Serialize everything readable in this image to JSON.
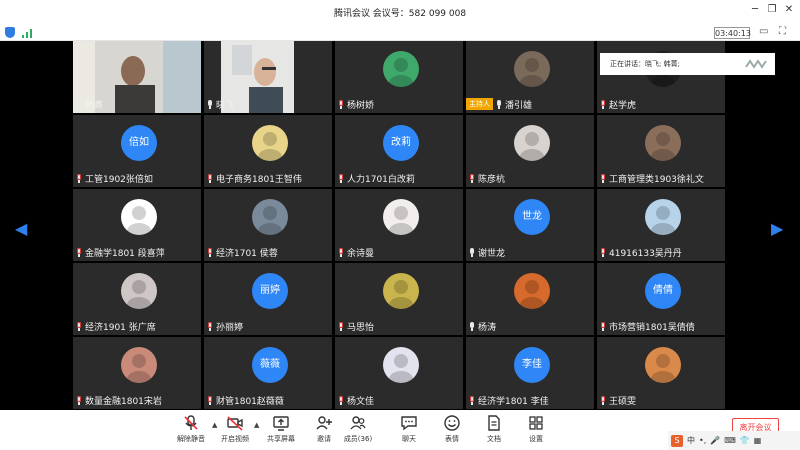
{
  "window": {
    "title": "腾讯会议  会议号：582 099 008"
  },
  "infobar": {
    "timer": "03:40:13"
  },
  "speaking": {
    "text": "正在讲话：晓飞; 韩菁;"
  },
  "host_badge": "主持人",
  "participants": [
    {
      "name": "韩菁",
      "type": "video",
      "mic": "on"
    },
    {
      "name": "晓飞",
      "type": "video",
      "mic": "on"
    },
    {
      "name": "杨树娇",
      "type": "photo",
      "mic": "muted",
      "color": "#3fa86b"
    },
    {
      "name": "潘引雄",
      "type": "photo",
      "mic": "on",
      "host": true,
      "color": "#7a6a5a"
    },
    {
      "name": "赵学虎",
      "type": "photo",
      "mic": "muted",
      "color": "#1f1f1f"
    },
    {
      "name": "工管1902张倍如",
      "type": "text",
      "avatar": "倍如",
      "mic": "muted"
    },
    {
      "name": "电子商务1801王智伟",
      "type": "photo",
      "mic": "muted",
      "color": "#e8d58a"
    },
    {
      "name": "人力1701白改莉",
      "type": "text",
      "avatar": "改莉",
      "mic": "muted"
    },
    {
      "name": "陈彦杭",
      "type": "photo",
      "mic": "muted",
      "color": "#d9d3cf"
    },
    {
      "name": "工商管理类1903徐礼文",
      "type": "photo",
      "mic": "muted",
      "color": "#8a6e5a"
    },
    {
      "name": "金融学1801 段喜萍",
      "type": "photo",
      "mic": "muted",
      "color": "#ffffff"
    },
    {
      "name": "经济1701 侯蓉",
      "type": "photo",
      "mic": "muted",
      "color": "#7a8a9a"
    },
    {
      "name": "余诗曼",
      "type": "photo",
      "mic": "muted",
      "color": "#f3eeee"
    },
    {
      "name": "谢世龙",
      "type": "text",
      "avatar": "世龙",
      "mic": "on"
    },
    {
      "name": "41916133吴丹丹",
      "type": "photo",
      "mic": "muted",
      "color": "#b7d3ea"
    },
    {
      "name": "经济1901 张广席",
      "type": "photo",
      "mic": "muted",
      "color": "#cfc6c6"
    },
    {
      "name": "孙丽婷",
      "type": "text",
      "avatar": "丽婷",
      "mic": "muted"
    },
    {
      "name": "马思怡",
      "type": "photo",
      "mic": "muted",
      "color": "#c9b44d"
    },
    {
      "name": "杨涛",
      "type": "photo",
      "mic": "on",
      "color": "#d66a2c"
    },
    {
      "name": "市场营销1801吴倩倩",
      "type": "text",
      "avatar": "倩倩",
      "mic": "muted"
    },
    {
      "name": "数量金融1801宋岩",
      "type": "photo",
      "mic": "muted",
      "color": "#c98a7a"
    },
    {
      "name": "财管1801赵薇薇",
      "type": "text",
      "avatar": "薇薇",
      "mic": "muted"
    },
    {
      "name": "杨文佳",
      "type": "photo",
      "mic": "muted",
      "color": "#e3e3ef"
    },
    {
      "name": "经济学1801 李佳",
      "type": "text",
      "avatar": "李佳",
      "mic": "muted"
    },
    {
      "name": "王硕雯",
      "type": "photo",
      "mic": "muted",
      "color": "#d9894a"
    }
  ],
  "toolbar": {
    "mute_all": "解除静音",
    "video": "开启视频",
    "share": "共享屏幕",
    "invite": "邀请",
    "members": "成员(36)",
    "chat": "聊天",
    "emoji": "表情",
    "docs": "文档",
    "settings": "设置",
    "leave": "离开会议"
  },
  "ime": {
    "label": "中"
  }
}
